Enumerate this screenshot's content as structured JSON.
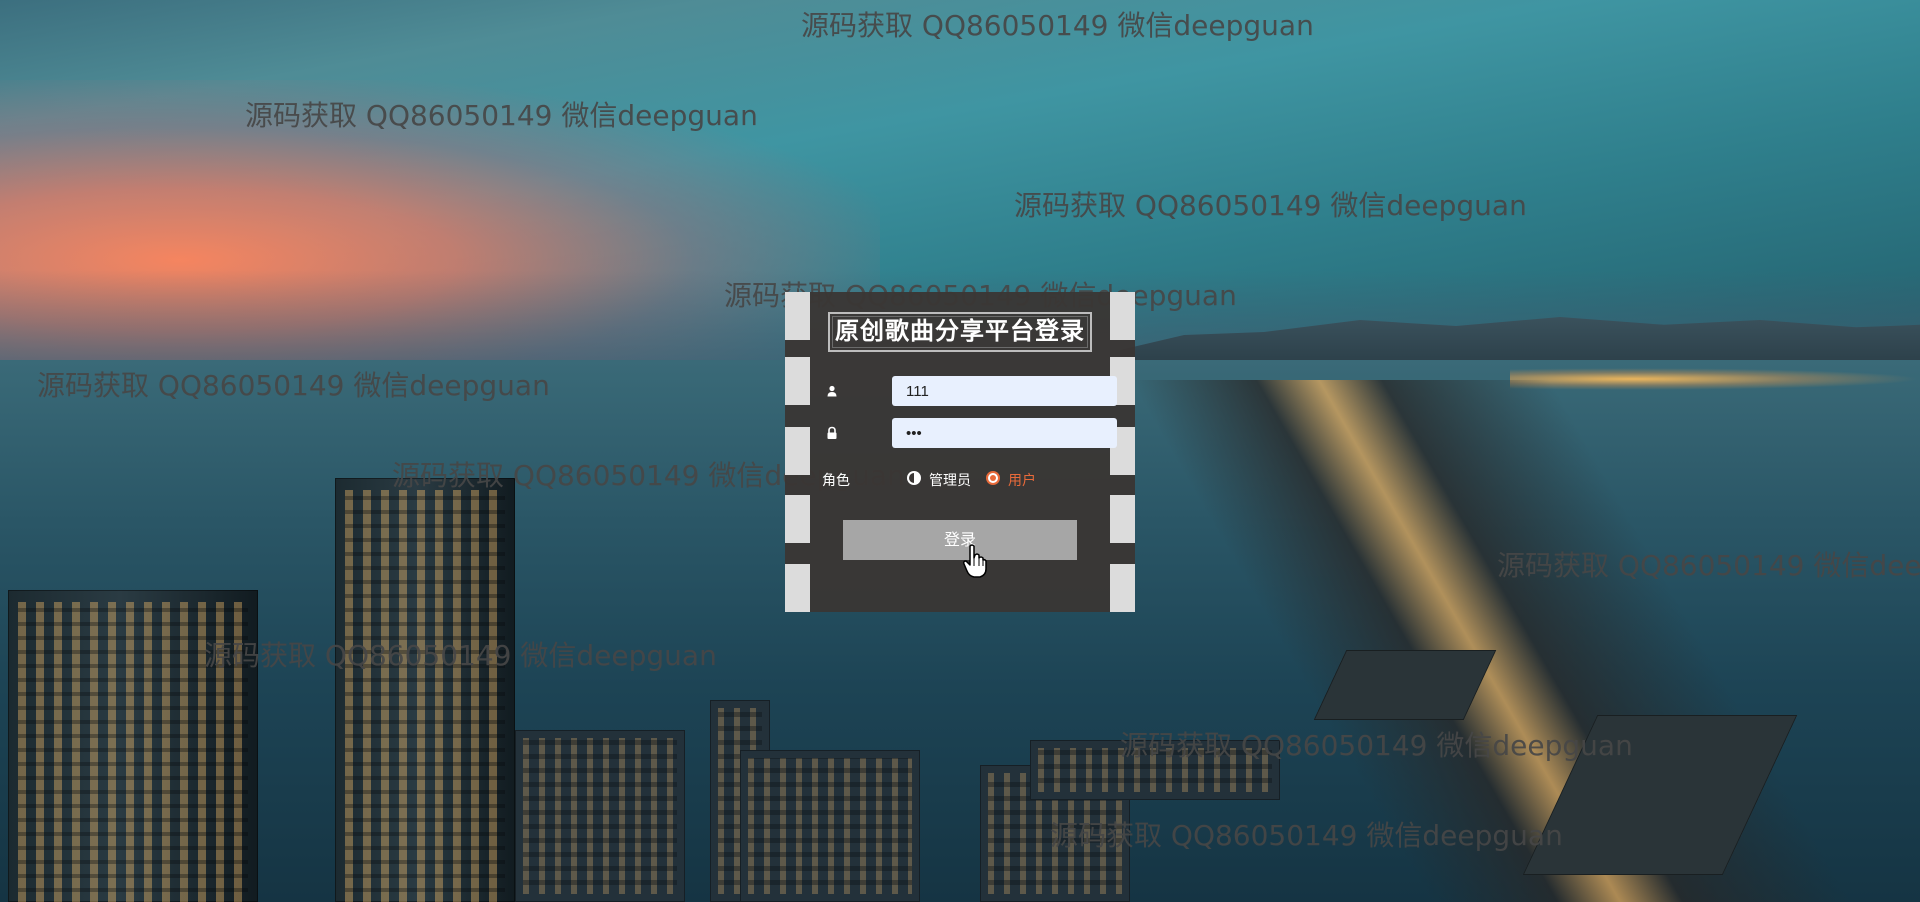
{
  "watermark_text": "源码获取 QQ86050149 微信deepguan",
  "login": {
    "title": "原创歌曲分享平台登录",
    "username_value": "111",
    "password_value": "•••",
    "role_label": "角色",
    "role_options": [
      "管理员",
      "用户"
    ],
    "selected_role": "用户",
    "submit_label": "登录"
  },
  "colors": {
    "accent": "#e86a3a",
    "button": "#a6a6a6",
    "input_bg": "#e8f0fe",
    "panel_bg": "#3a3634"
  },
  "icons": {
    "username": "user-icon",
    "password": "lock-icon",
    "cursor": "pointer-hand-icon"
  }
}
